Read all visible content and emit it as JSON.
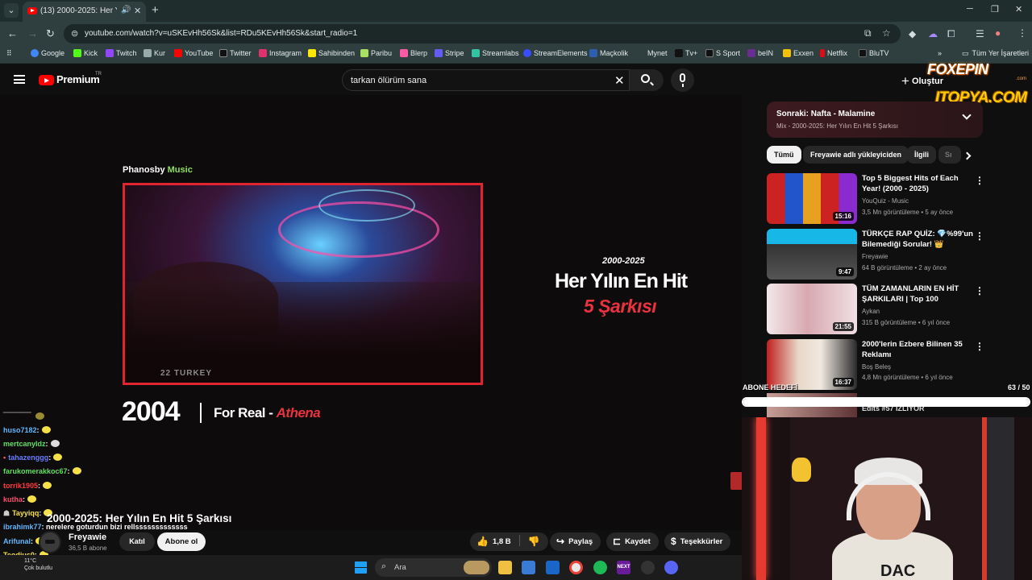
{
  "browser": {
    "tab_title": "(13) 2000-2025: Her Yılın En Hit 5 Şarkısı",
    "url": "youtube.com/watch?v=uSKEvHh56Sk&list=RDu5KEvHh56Sk&start_radio=1",
    "bookmarks": [
      "Google",
      "Kick",
      "Twitch",
      "Kur",
      "YouTube",
      "Twitter",
      "Instagram",
      "Sahibinden",
      "Paribu",
      "Blerp",
      "Stripe",
      "Streamlabs",
      "StreamElements",
      "Maçkolik",
      "Mynet",
      "Tv+",
      "S Sport",
      "beIN",
      "Exxen",
      "Netflix",
      "BluTV"
    ],
    "bookmarks_more": "»",
    "all_bookmarks": "Tüm Yer İşaretleri"
  },
  "youtube": {
    "brand": "Premium",
    "country": "TR",
    "search_query": "tarkan ölürüm sana",
    "create_label": "Oluştur"
  },
  "overlay": {
    "foxepin": "FOXEPIN",
    "foxepin_com": ".com",
    "itopya": "ITOPYA.COM"
  },
  "video": {
    "label_brand": "Phanosby",
    "label_music": "Music",
    "caption": "22  TURKEY",
    "subtitle": "2000-2025",
    "title_line1": "Her Yılın En Hit",
    "title_line2": "5 Şarkısı",
    "year": "2004",
    "song": "For Real - ",
    "artist": "Athena"
  },
  "chat": [
    {
      "user": "huso7182",
      "msg": ":",
      "color": "#5fb8ff"
    },
    {
      "user": "mertcanyldz",
      "msg": ":",
      "color": "#5fe05f"
    },
    {
      "user": "tahazenggg",
      "msg": ":",
      "color": "#6a7cff"
    },
    {
      "user": "farukomerakkoc67",
      "msg": ":",
      "color": "#5fe05f"
    },
    {
      "user": "torrik1905",
      "msg": ":",
      "color": "#ff3a3a"
    },
    {
      "user": "kutha",
      "msg": ":",
      "color": "#ff4a6a"
    },
    {
      "user": "Tayyiqq",
      "msg": ":",
      "color": "#f5e04a"
    },
    {
      "user": "ibrahimk77",
      "msg": ": nerelere goturdun bizi rellsssssssssssss",
      "color": "#5fb8ff"
    },
    {
      "user": "Arifunal",
      "msg": ":",
      "color": "#5fb8ff"
    },
    {
      "user": "Teodius0",
      "msg": ":",
      "color": "#f5e04a"
    }
  ],
  "watch": {
    "title": "2000-2025: Her Yılın En Hit 5 Şarkısı",
    "channel": "Freyawie",
    "subscribers": "36,5 B abone",
    "join": "Katıl",
    "subscribe": "Abone ol",
    "likes": "1,8 B",
    "share": "Paylaş",
    "save": "Kaydet",
    "thanks": "Teşekkürler"
  },
  "sidebar": {
    "upnext_title": "Sonraki: Nafta - Malamine",
    "upnext_sub": "Mix - 2000-2025: Her Yılın En Hit 5 Şarkısı",
    "chips": [
      "Tümü",
      "Freyawie adlı yükleyiciden",
      "İlgili",
      "Sı"
    ],
    "recs": [
      {
        "title": "Top 5 Biggest Hits of Each Year! (2000 - 2025)",
        "channel": "YouQuiz - Music",
        "meta": "3,5 Mn görüntüleme • 5 ay önce",
        "duration": "15:16"
      },
      {
        "title": "TÜRKÇE RAP QUİZ: 💎%99'un Bilemediği Sorular! 👑",
        "channel": "Freyawie",
        "meta": "64 B görüntüleme • 2 ay önce",
        "duration": "9:47"
      },
      {
        "title": "TÜM ZAMANLARIN EN HİT ŞARKILARI | Top 100",
        "channel": "Aykan",
        "meta": "315 B görüntüleme • 6 yıl önce",
        "duration": "21:55"
      },
      {
        "title": "2000'lerin Ezbere Bilinen 35 Reklamı",
        "channel": "Boş Beleş",
        "meta": "4,8 Mn görüntüleme • 6 yıl önce",
        "duration": "16:37"
      }
    ],
    "rec5_title": "Edits #57 İZLİYOR"
  },
  "goal": {
    "label": "ABONE HEDEFİ",
    "count": "63 / 50",
    "fraction": 1.0
  },
  "webcam": {
    "shirt_text": "DAC"
  },
  "taskbar": {
    "weather_temp": "11°C",
    "weather_desc": "Çok bulutlu",
    "search": "Ara"
  }
}
